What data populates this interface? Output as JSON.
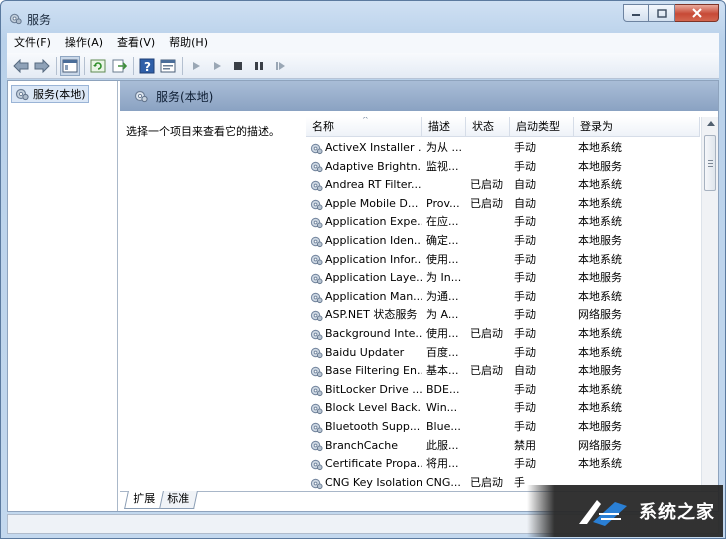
{
  "window": {
    "title": "服务"
  },
  "menubar": {
    "items": [
      "文件(F)",
      "操作(A)",
      "查看(V)",
      "帮助(H)"
    ]
  },
  "toolbar": {
    "icons": [
      "back-arrow-icon",
      "forward-arrow-icon",
      "show-hide-tree-icon",
      "refresh-icon",
      "export-list-icon",
      "help-icon",
      "properties-icon",
      "start-service-icon",
      "start-service-alt-icon",
      "stop-service-icon",
      "pause-service-icon",
      "resume-service-icon"
    ]
  },
  "tree": {
    "root_label": "服务(本地)"
  },
  "pane": {
    "header_title": "服务(本地)",
    "description_prompt": "选择一个项目来查看它的描述。"
  },
  "list": {
    "columns": [
      "名称",
      "描述",
      "状态",
      "启动类型",
      "登录为"
    ],
    "rows": [
      {
        "name": "ActiveX Installer ...",
        "desc": "为从 ...",
        "status": "",
        "startup": "手动",
        "logon": "本地系统"
      },
      {
        "name": "Adaptive Brightn...",
        "desc": "监视...",
        "status": "",
        "startup": "手动",
        "logon": "本地服务"
      },
      {
        "name": "Andrea RT Filter...",
        "desc": "",
        "status": "已启动",
        "startup": "自动",
        "logon": "本地系统"
      },
      {
        "name": "Apple Mobile D...",
        "desc": "Prov...",
        "status": "已启动",
        "startup": "自动",
        "logon": "本地系统"
      },
      {
        "name": "Application Expe...",
        "desc": "在应...",
        "status": "",
        "startup": "手动",
        "logon": "本地系统"
      },
      {
        "name": "Application Iden...",
        "desc": "确定...",
        "status": "",
        "startup": "手动",
        "logon": "本地服务"
      },
      {
        "name": "Application Infor...",
        "desc": "使用...",
        "status": "",
        "startup": "手动",
        "logon": "本地系统"
      },
      {
        "name": "Application Laye...",
        "desc": "为 In...",
        "status": "",
        "startup": "手动",
        "logon": "本地服务"
      },
      {
        "name": "Application Man...",
        "desc": "为通...",
        "status": "",
        "startup": "手动",
        "logon": "本地系统"
      },
      {
        "name": "ASP.NET 状态服务",
        "desc": "为 A...",
        "status": "",
        "startup": "手动",
        "logon": "网络服务"
      },
      {
        "name": "Background Inte...",
        "desc": "使用...",
        "status": "已启动",
        "startup": "手动",
        "logon": "本地系统"
      },
      {
        "name": "Baidu Updater",
        "desc": "百度...",
        "status": "",
        "startup": "手动",
        "logon": "本地系统"
      },
      {
        "name": "Base Filtering En...",
        "desc": "基本...",
        "status": "已启动",
        "startup": "自动",
        "logon": "本地服务"
      },
      {
        "name": "BitLocker Drive ...",
        "desc": "BDE...",
        "status": "",
        "startup": "手动",
        "logon": "本地系统"
      },
      {
        "name": "Block Level Back...",
        "desc": "Win...",
        "status": "",
        "startup": "手动",
        "logon": "本地系统"
      },
      {
        "name": "Bluetooth Supp...",
        "desc": "Blue...",
        "status": "",
        "startup": "手动",
        "logon": "本地服务"
      },
      {
        "name": "BranchCache",
        "desc": "此服...",
        "status": "",
        "startup": "禁用",
        "logon": "网络服务"
      },
      {
        "name": "Certificate Propa...",
        "desc": "将用...",
        "status": "",
        "startup": "手动",
        "logon": "本地系统"
      },
      {
        "name": "CNG Key Isolation",
        "desc": "CNG...",
        "status": "已启动",
        "startup": "手",
        "logon": ""
      }
    ]
  },
  "tabs": {
    "extended": "扩展",
    "standard": "标准"
  },
  "watermark": {
    "text": "系统之家"
  }
}
